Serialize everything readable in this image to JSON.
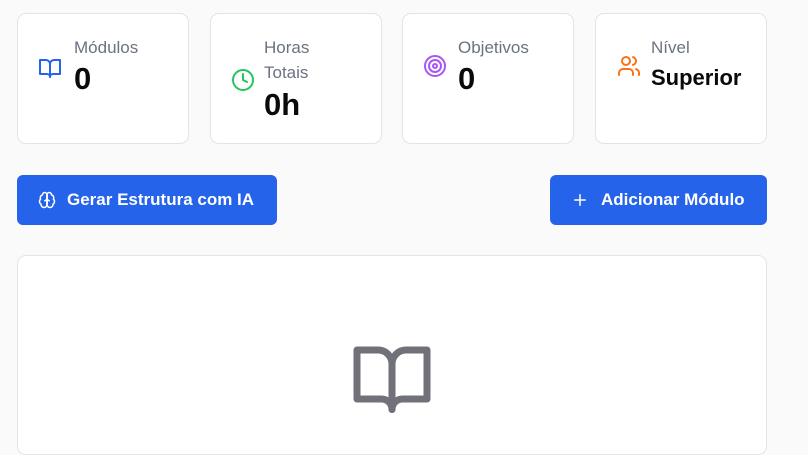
{
  "stats": [
    {
      "label": "Módulos",
      "value": "0",
      "icon": "book-open-icon",
      "color": "#2563eb"
    },
    {
      "label": "Horas Totais",
      "value": "0h",
      "icon": "clock-icon",
      "color": "#22c55e"
    },
    {
      "label": "Objetivos",
      "value": "0",
      "icon": "target-icon",
      "color": "#a855f7"
    },
    {
      "label": "Nível",
      "value": "Superior",
      "icon": "users-icon",
      "color": "#f97316"
    }
  ],
  "actions": {
    "generate_label": "Gerar Estrutura com IA",
    "generate_icon": "brain-icon",
    "add_label": "Adicionar Módulo",
    "add_icon": "plus-icon",
    "button_color": "#2563eb"
  },
  "empty_state": {
    "icon": "book-open-icon",
    "icon_color": "#71717a"
  }
}
